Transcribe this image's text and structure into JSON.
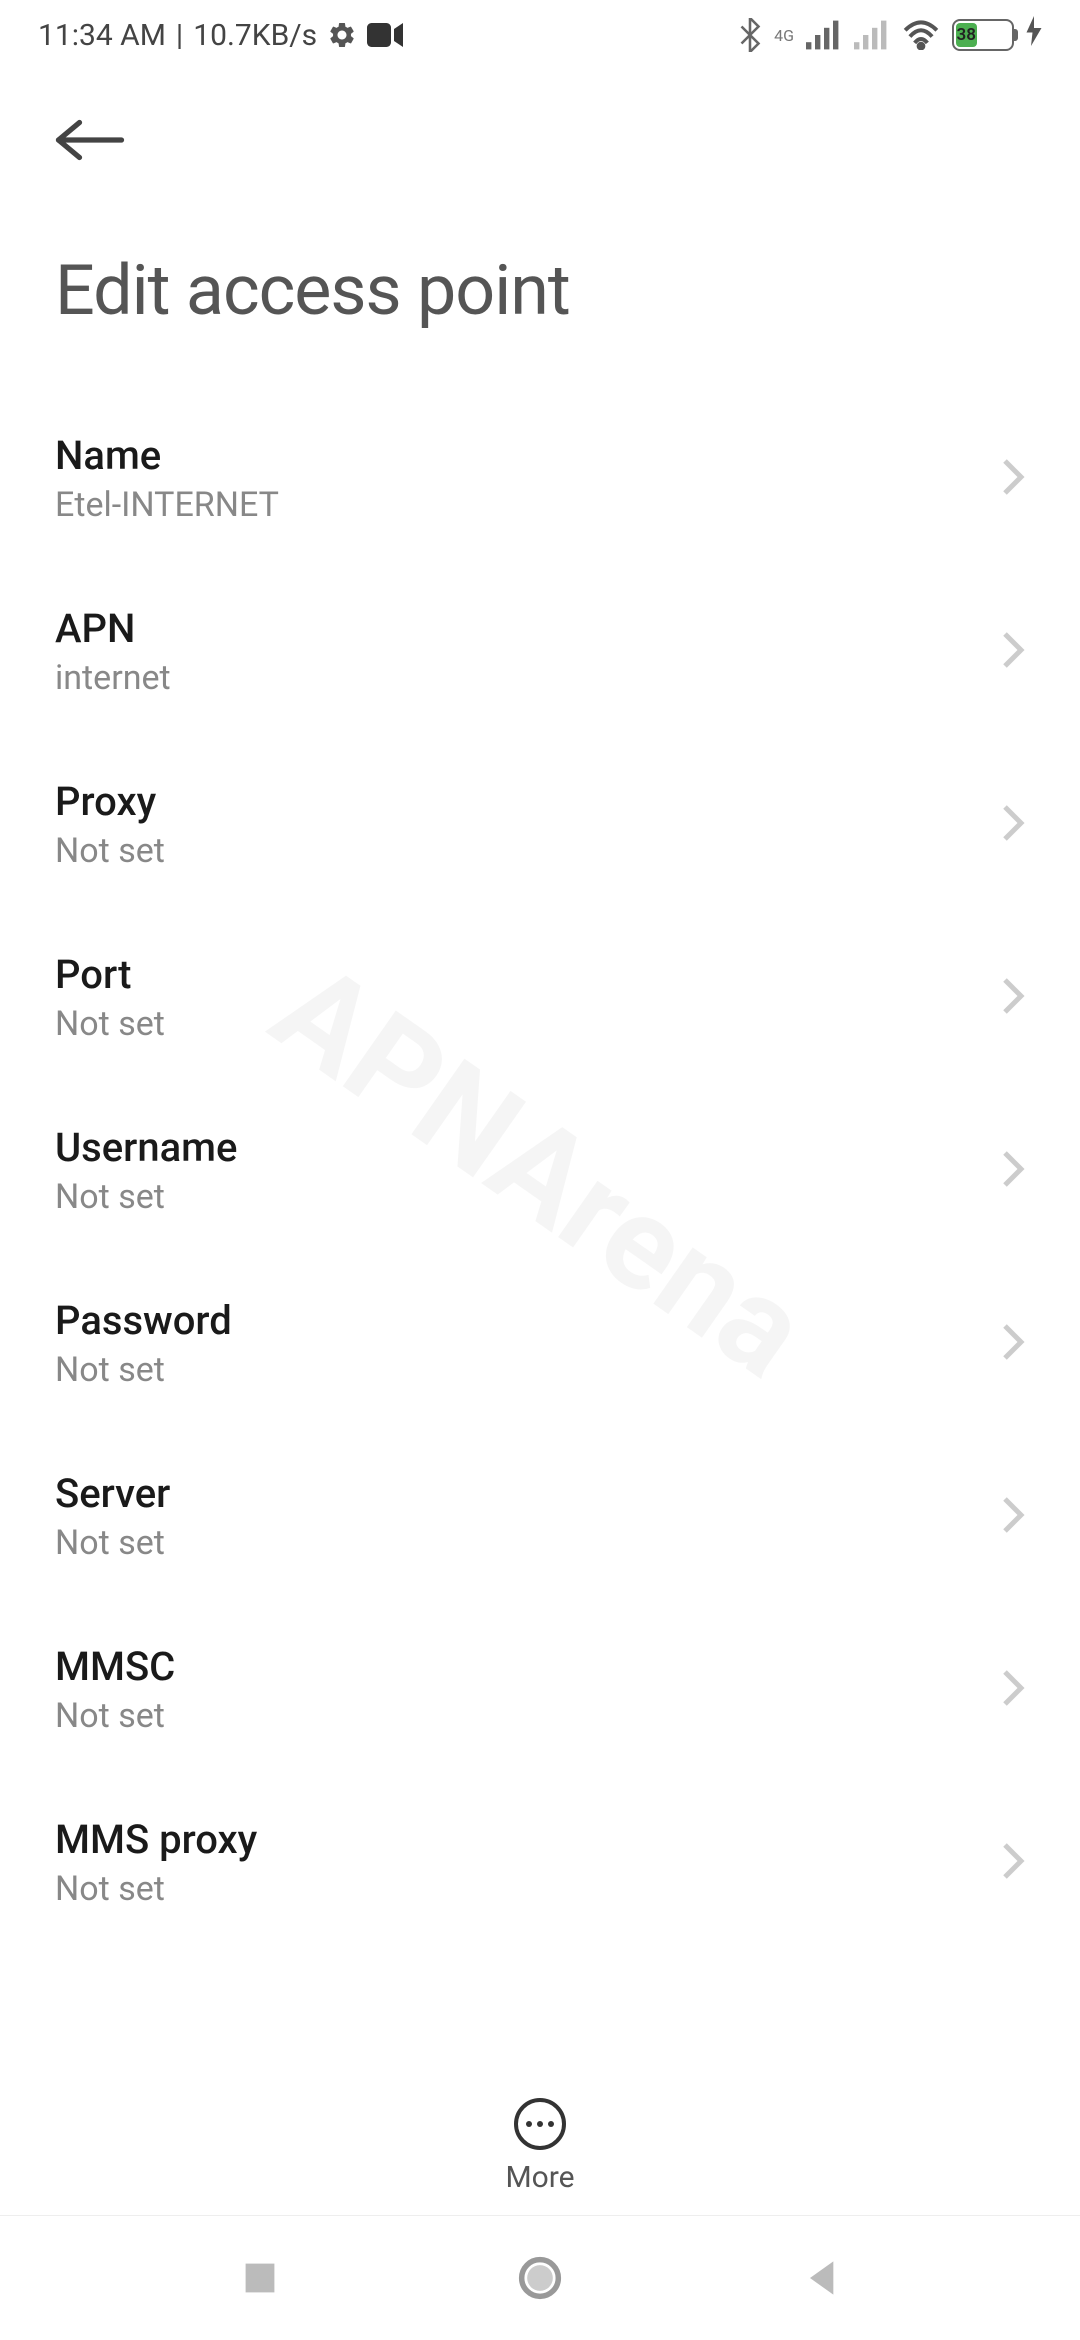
{
  "status": {
    "time": "11:34 AM",
    "speed": "10.7KB/s",
    "network_label": "4G",
    "battery_level": "38"
  },
  "header": {
    "title": "Edit access point"
  },
  "settings": [
    {
      "label": "Name",
      "value": "Etel-INTERNET"
    },
    {
      "label": "APN",
      "value": "internet"
    },
    {
      "label": "Proxy",
      "value": "Not set"
    },
    {
      "label": "Port",
      "value": "Not set"
    },
    {
      "label": "Username",
      "value": "Not set"
    },
    {
      "label": "Password",
      "value": "Not set"
    },
    {
      "label": "Server",
      "value": "Not set"
    },
    {
      "label": "MMSC",
      "value": "Not set"
    },
    {
      "label": "MMS proxy",
      "value": "Not set"
    }
  ],
  "toolbar": {
    "more_label": "More"
  },
  "watermark": "APNArena"
}
